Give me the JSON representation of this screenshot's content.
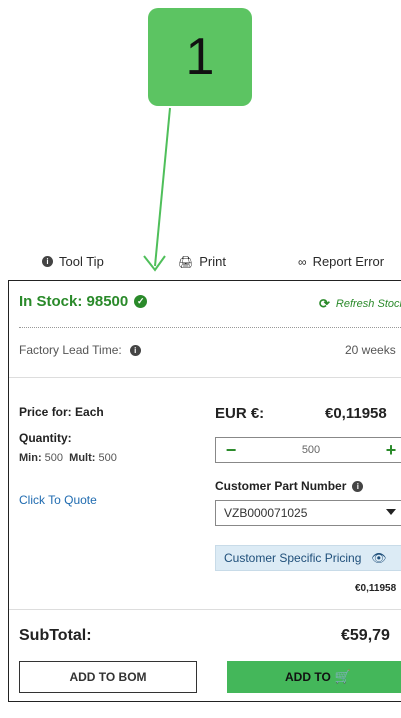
{
  "callout": {
    "number": "1"
  },
  "toolbar": {
    "tooltip": "Tool Tip",
    "print": "Print",
    "report": "Report Error"
  },
  "stock": {
    "label": "In Stock: 98500",
    "refresh": "Refresh Stock"
  },
  "lead_time": {
    "label": "Factory Lead Time:",
    "value": "20 weeks"
  },
  "pricing": {
    "price_for": "Price for: Each",
    "quantity_label": "Quantity:",
    "min_label": "Min:",
    "min_value": "500",
    "mult_label": "Mult:",
    "mult_value": "500",
    "click_to_quote": "Click To Quote",
    "currency": "EUR €:",
    "unit_price": "€0,11958",
    "quantity": "500",
    "customer_part_label": "Customer Part Number",
    "customer_part_value": "VZB000071025",
    "customer_specific": "Customer Specific Pricing",
    "customer_specific_price": "€0,11958"
  },
  "subtotal": {
    "label": "SubTotal:",
    "value": "€59,79"
  },
  "buttons": {
    "add_to_bom": "ADD TO BOM",
    "add_to": "ADD TO"
  },
  "colors": {
    "accent_green": "#44b75a",
    "stock_green": "#2a8a2a",
    "link_blue": "#1f6bb0",
    "callout_green": "#5cc462"
  }
}
